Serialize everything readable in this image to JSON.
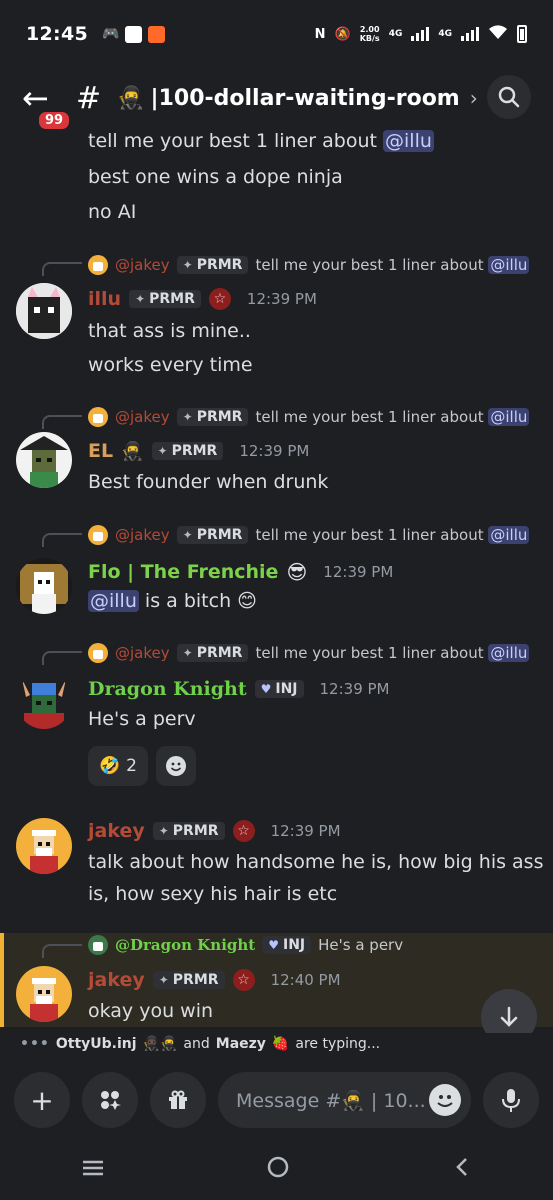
{
  "status_bar": {
    "time": "12:45",
    "speed_value": "2.00",
    "speed_unit": "KB/s",
    "net1": "4G",
    "net2": "4G"
  },
  "header": {
    "unread_badge": "99",
    "channel_name": "100-dollar-waiting-room"
  },
  "top_lines": [
    "tell me your best 1 liner about ",
    "best one wins a dope ninja",
    "no AI"
  ],
  "mention_illu": "@illu",
  "reply_name_jakey": "@jakey",
  "reply_text": "tell me your best 1 liner about ",
  "tag_prmr": "PRMR",
  "tag_inj": "INJ",
  "messages": [
    {
      "author": "illu",
      "time": "12:39 PM",
      "lines": [
        "that ass is mine..",
        "works every time"
      ]
    },
    {
      "author": "EL",
      "time": "12:39 PM",
      "lines": [
        "Best founder when drunk"
      ]
    },
    {
      "author": "Flo | The Frenchie",
      "time": "12:39 PM",
      "text_after": " is a bitch"
    },
    {
      "author": "Dragon Knight",
      "time": "12:39 PM",
      "lines": [
        "He's a perv"
      ],
      "reaction_count": "2"
    },
    {
      "author": "jakey",
      "time": "12:39 PM",
      "lines": [
        "talk about how handsome he is, how big his ass",
        "is, how sexy his hair is etc"
      ]
    },
    {
      "author": "jakey",
      "time": "12:40 PM",
      "lines": [
        "okay you win"
      ],
      "reply_name": "@Dragon Knight",
      "reply_text": "He's a perv"
    }
  ],
  "typing": {
    "user1": "OttyUb.inj",
    "mid": "and",
    "user2": "Maezy",
    "suffix": "are typing..."
  },
  "composer": {
    "placeholder": "Message #🥷 | 10..."
  },
  "colors": {
    "background": "#1e1f22",
    "mention_bg": "#3c4270",
    "jakey": "#b44a38",
    "el": "#d9a05b",
    "flo": "#7cd34a",
    "dragon": "#6fd14a",
    "highlight": "#f0b232"
  }
}
